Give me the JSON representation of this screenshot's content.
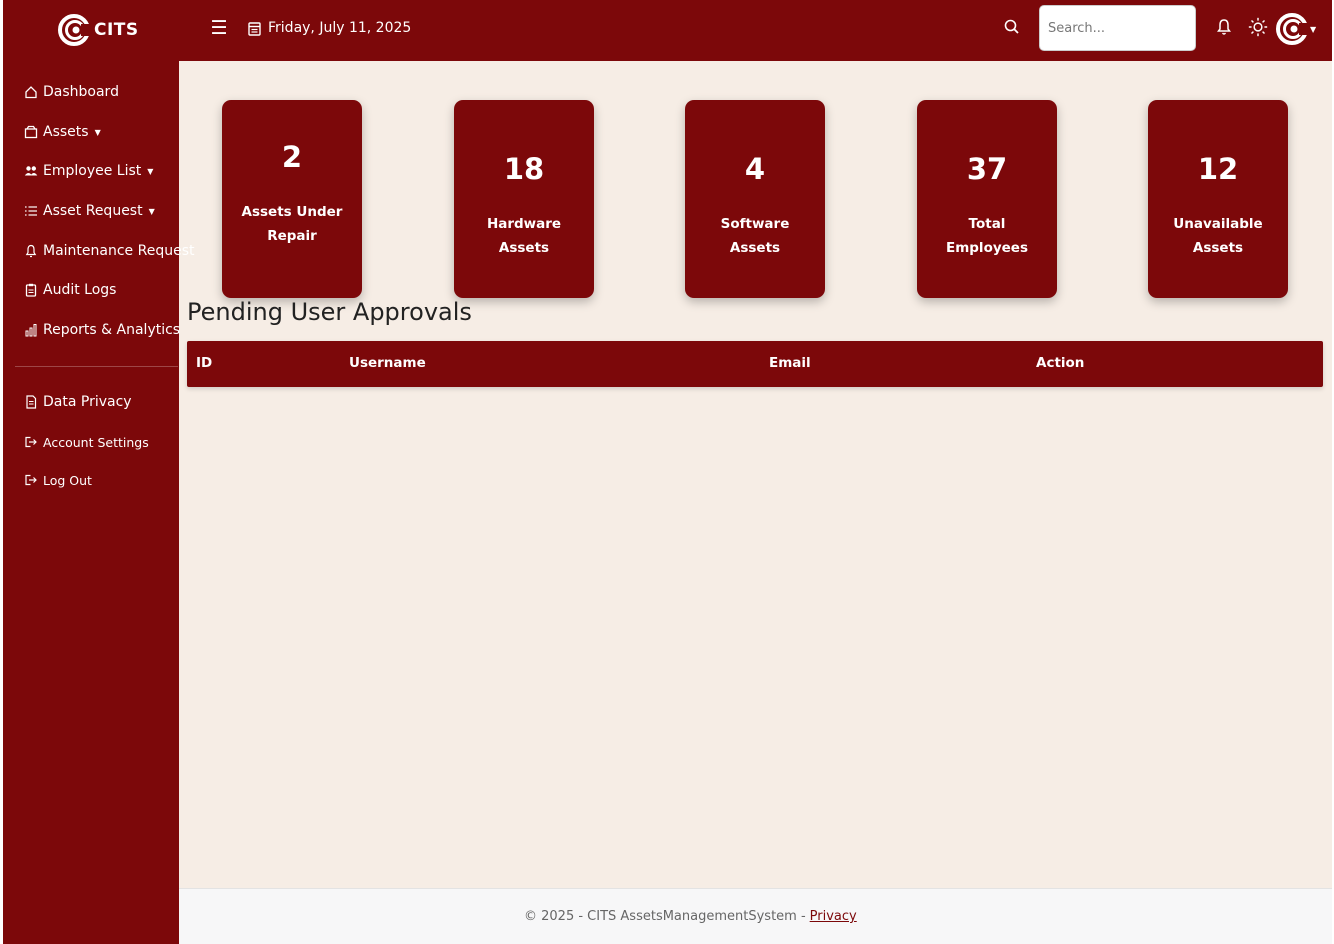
{
  "brand": {
    "name": "CITS"
  },
  "header": {
    "date": "Friday, July 11, 2025",
    "search_placeholder": "Search..."
  },
  "sidebar": {
    "items": [
      {
        "label": "Dashboard",
        "icon": "home-icon"
      },
      {
        "label": "Assets",
        "icon": "box-icon",
        "has_dropdown": true
      },
      {
        "label": "Employee List",
        "icon": "users-icon",
        "has_dropdown": true
      },
      {
        "label": "Asset Request",
        "icon": "list-icon",
        "has_dropdown": true
      },
      {
        "label": "Maintenance Request",
        "icon": "bell-icon"
      },
      {
        "label": "Audit Logs",
        "icon": "clipboard-icon"
      },
      {
        "label": "Reports & Analytics",
        "icon": "bar-chart-icon"
      }
    ],
    "bottom_items": [
      {
        "label": "Data Privacy",
        "icon": "document-icon"
      },
      {
        "label": "Account Settings",
        "icon": "sign-out-icon"
      },
      {
        "label": "Log Out",
        "icon": "sign-out-icon"
      }
    ]
  },
  "cards": [
    {
      "value": "2",
      "label": "Assets Under Repair"
    },
    {
      "value": "18",
      "label": "Hardware Assets"
    },
    {
      "value": "4",
      "label": "Software Assets"
    },
    {
      "value": "37",
      "label": "Total Employees"
    },
    {
      "value": "12",
      "label": "Unavailable Assets"
    }
  ],
  "approvals": {
    "title": "Pending User Approvals",
    "columns": [
      "ID",
      "Username",
      "Email",
      "Action"
    ],
    "rows": []
  },
  "footer": {
    "text": "© 2025 - CITS AssetsManagementSystem -",
    "link": "Privacy"
  },
  "colors": {
    "primary": "#7c080a",
    "background": "#f6ede5",
    "footer_bg": "#f7f7f8"
  }
}
